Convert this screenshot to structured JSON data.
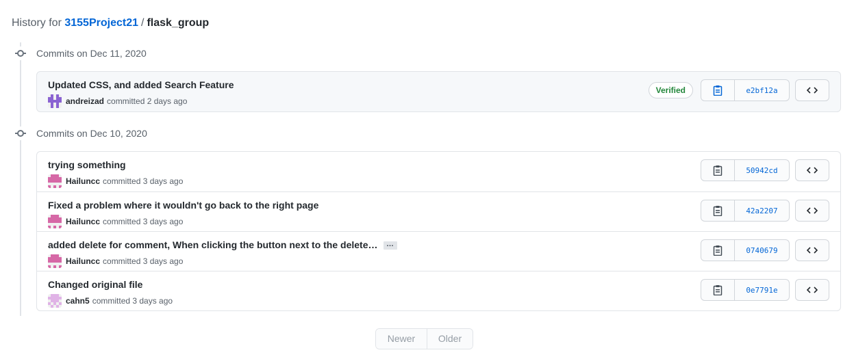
{
  "header": {
    "prefix": "History for",
    "owner": "3155Project21",
    "separator": "/",
    "repo": "flask_group"
  },
  "groups": [
    {
      "label": "Commits on Dec 11, 2020",
      "commits": [
        {
          "message": "Updated CSS, and added Search Feature",
          "author": "andreizad",
          "time": "committed 2 days ago",
          "sha": "e2bf12a",
          "verified": "Verified"
        }
      ]
    },
    {
      "label": "Commits on Dec 10, 2020",
      "commits": [
        {
          "message": "trying something",
          "author": "Hailuncc",
          "time": "committed 3 days ago",
          "sha": "50942cd"
        },
        {
          "message": "Fixed a problem where it wouldn't go back to the right page",
          "author": "Hailuncc",
          "time": "committed 3 days ago",
          "sha": "42a2207"
        },
        {
          "message": "added delete for comment, When clicking the button next to the delete…",
          "author": "Hailuncc",
          "time": "committed 3 days ago",
          "sha": "0740679",
          "ellipsis": "…"
        },
        {
          "message": "Changed original file",
          "author": "cahn5",
          "time": "committed 3 days ago",
          "sha": "0e7791e"
        }
      ]
    }
  ],
  "pagination": {
    "newer": "Newer",
    "older": "Older"
  },
  "colors": {
    "link": "#0366d6",
    "verified": "#22863a",
    "avatar_andreizad": "#8a63d2",
    "avatar_hailuncc": "#d668a6",
    "avatar_cahn5": "#e0b3e6"
  },
  "icons": {
    "commit": "git-commit-icon",
    "clipboard": "clipboard-icon",
    "browse": "code-icon"
  }
}
